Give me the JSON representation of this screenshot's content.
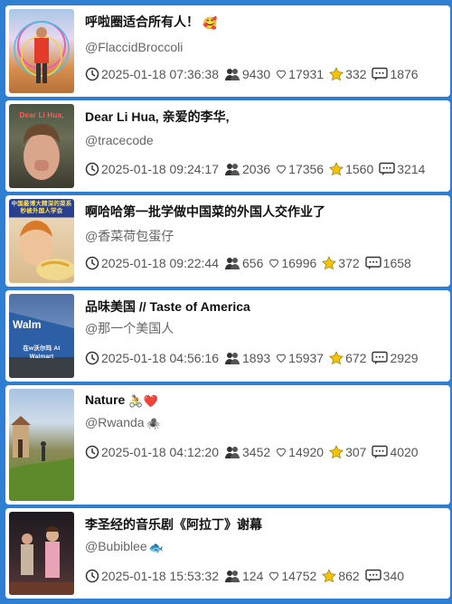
{
  "items": [
    {
      "title": "呼啦圈适合所有人！",
      "title_emoji": "🥰",
      "author": "@FlaccidBroccoli",
      "author_emoji": "",
      "datetime": "2025-01-18 07:36:38",
      "followers": "9430",
      "likes": "17931",
      "stars": "332",
      "comments": "1876",
      "thumb_caption": ""
    },
    {
      "title": "Dear Li Hua, 亲爱的李华,",
      "title_emoji": "",
      "author": "@tracecode",
      "author_emoji": "",
      "datetime": "2025-01-18 09:24:17",
      "followers": "2036",
      "likes": "17356",
      "stars": "1560",
      "comments": "3214",
      "thumb_caption": "Dear Li Hua,"
    },
    {
      "title": "啊哈哈第一批学做中国菜的外国人交作业了",
      "title_emoji": "",
      "author": "@香菜荷包蛋仔",
      "author_emoji": "",
      "datetime": "2025-01-18 09:22:44",
      "followers": "656",
      "likes": "16996",
      "stars": "372",
      "comments": "1658",
      "thumb_caption": "中国最博大精深的菜系 秒被外国人学会"
    },
    {
      "title": "品味美国 // Taste of America",
      "title_emoji": "",
      "author": "@那一个美国人",
      "author_emoji": "",
      "datetime": "2025-01-18 04:56:16",
      "followers": "1893",
      "likes": "15937",
      "stars": "672",
      "comments": "2929",
      "thumb_caption": "在w沃尔玛 At Walmart"
    },
    {
      "title": "Nature",
      "title_emoji": "🚴❤️",
      "author": "@Rwanda",
      "author_emoji": "🕷️",
      "datetime": "2025-01-18 04:12:20",
      "followers": "3452",
      "likes": "14920",
      "stars": "307",
      "comments": "4020",
      "thumb_caption": ""
    },
    {
      "title": "李圣经的音乐剧《阿拉丁》谢幕",
      "title_emoji": "",
      "author": "@Bubiblee",
      "author_emoji": "🐟",
      "datetime": "2025-01-18 15:53:32",
      "followers": "124",
      "likes": "14752",
      "stars": "862",
      "comments": "340",
      "thumb_caption": ""
    }
  ],
  "icons": {
    "time": "clock-icon",
    "followers": "people-icon",
    "likes": "heart-icon",
    "stars": "star-icon",
    "comments": "comment-icon"
  },
  "colors": {
    "background": "#2e7fd2",
    "card": "#ffffff",
    "star": "#f5c400"
  }
}
